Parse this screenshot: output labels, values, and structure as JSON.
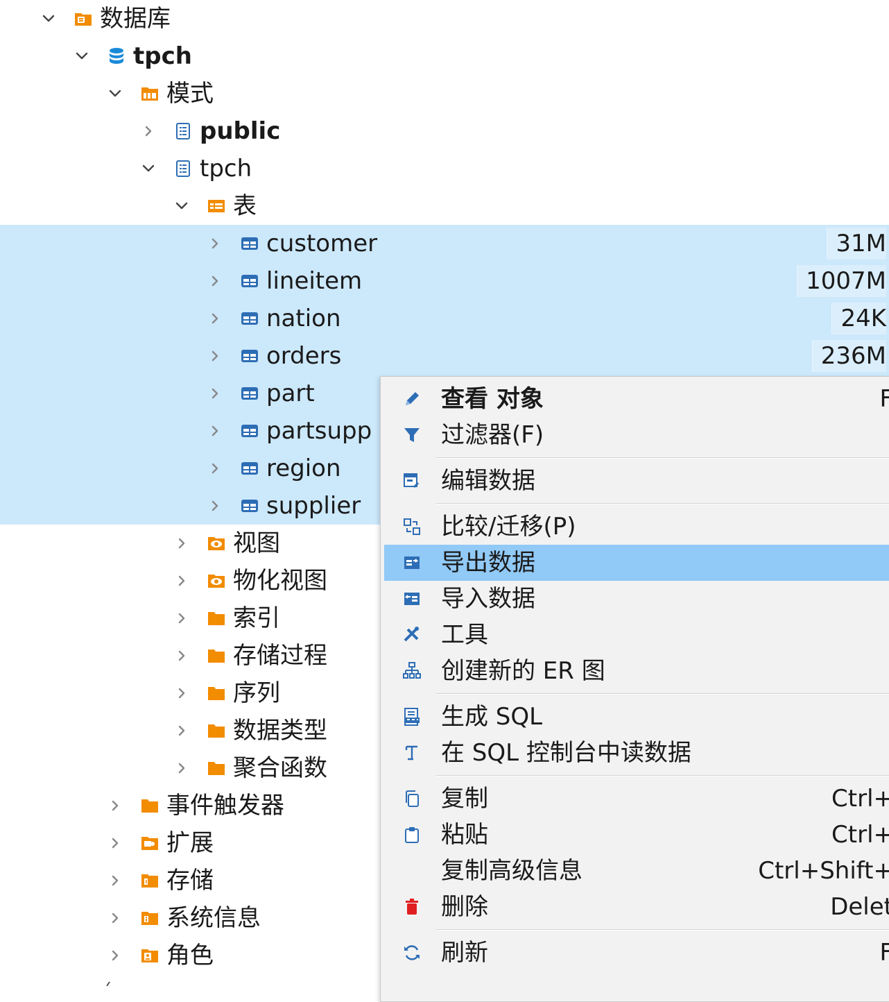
{
  "tree": {
    "rows": [
      {
        "label": "数据库",
        "indent": 0,
        "chevron": "down",
        "icon": "database-folder-icon"
      },
      {
        "label": "tpch",
        "indent": 1,
        "chevron": "down",
        "icon": "database-icon",
        "bold": true
      },
      {
        "label": "模式",
        "indent": 2,
        "chevron": "down",
        "icon": "schemas-folder-icon"
      },
      {
        "label": "public",
        "indent": 3,
        "chevron": "right",
        "icon": "schema-icon",
        "bold": true
      },
      {
        "label": "tpch",
        "indent": 3,
        "chevron": "down",
        "icon": "schema-icon"
      },
      {
        "label": "表",
        "indent": 4,
        "chevron": "down",
        "icon": "tables-folder-icon"
      },
      {
        "label": "customer",
        "indent": 5,
        "chevron": "right",
        "icon": "table-icon",
        "selected": true,
        "size": "31M"
      },
      {
        "label": "lineitem",
        "indent": 5,
        "chevron": "right",
        "icon": "table-icon",
        "selected": true,
        "size": "1007M"
      },
      {
        "label": "nation",
        "indent": 5,
        "chevron": "right",
        "icon": "table-icon",
        "selected": true,
        "size": "24K"
      },
      {
        "label": "orders",
        "indent": 5,
        "chevron": "right",
        "icon": "table-icon",
        "selected": true,
        "size": "236M"
      },
      {
        "label": "part",
        "indent": 5,
        "chevron": "right",
        "icon": "table-icon",
        "selected": true
      },
      {
        "label": "partsupp",
        "indent": 5,
        "chevron": "right",
        "icon": "table-icon",
        "selected": true
      },
      {
        "label": "region",
        "indent": 5,
        "chevron": "right",
        "icon": "table-icon",
        "selected": true
      },
      {
        "label": "supplier",
        "indent": 5,
        "chevron": "right",
        "icon": "table-icon",
        "selected": true
      },
      {
        "label": "视图",
        "indent": 4,
        "chevron": "right",
        "icon": "view-folder-icon"
      },
      {
        "label": "物化视图",
        "indent": 4,
        "chevron": "right",
        "icon": "view-folder-icon"
      },
      {
        "label": "索引",
        "indent": 4,
        "chevron": "right",
        "icon": "folder-icon"
      },
      {
        "label": "存储过程",
        "indent": 4,
        "chevron": "right",
        "icon": "folder-icon"
      },
      {
        "label": "序列",
        "indent": 4,
        "chevron": "right",
        "icon": "folder-icon"
      },
      {
        "label": "数据类型",
        "indent": 4,
        "chevron": "right",
        "icon": "folder-icon"
      },
      {
        "label": "聚合函数",
        "indent": 4,
        "chevron": "right",
        "icon": "folder-icon"
      },
      {
        "label": "事件触发器",
        "indent": 2,
        "chevron": "right",
        "icon": "folder-icon"
      },
      {
        "label": "扩展",
        "indent": 2,
        "chevron": "right",
        "icon": "extension-folder-icon"
      },
      {
        "label": "存储",
        "indent": 2,
        "chevron": "right",
        "icon": "storage-folder-icon"
      },
      {
        "label": "系统信息",
        "indent": 2,
        "chevron": "right",
        "icon": "system-info-folder-icon"
      },
      {
        "label": "角色",
        "indent": 2,
        "chevron": "right",
        "icon": "roles-folder-icon"
      }
    ]
  },
  "context_menu": {
    "items": [
      {
        "label": "查看 对象",
        "shortcut": "F",
        "icon": "pencil-icon",
        "bold": true
      },
      {
        "label": "过滤器(F)",
        "shortcut": "",
        "icon": "filter-icon"
      },
      {
        "separator": true
      },
      {
        "label": "编辑数据",
        "shortcut": "",
        "icon": "edit-data-icon"
      },
      {
        "separator": true
      },
      {
        "label": "比较/迁移(P)",
        "shortcut": "",
        "icon": "compare-icon"
      },
      {
        "label": "导出数据",
        "shortcut": "",
        "icon": "export-data-icon",
        "highlighted": true
      },
      {
        "label": "导入数据",
        "shortcut": "",
        "icon": "import-data-icon"
      },
      {
        "label": "工具",
        "shortcut": "",
        "icon": "tools-icon"
      },
      {
        "label": "创建新的 ER 图",
        "shortcut": "",
        "icon": "er-diagram-icon"
      },
      {
        "separator": true
      },
      {
        "label": "生成 SQL",
        "shortcut": "",
        "icon": "generate-sql-icon"
      },
      {
        "label": "在 SQL 控制台中读数据",
        "shortcut": "",
        "icon": "sql-console-icon"
      },
      {
        "separator": true
      },
      {
        "label": "复制",
        "shortcut": "Ctrl+",
        "icon": "copy-icon"
      },
      {
        "label": "粘贴",
        "shortcut": "Ctrl+",
        "icon": "paste-icon"
      },
      {
        "label": "复制高级信息",
        "shortcut": "Ctrl+Shift+",
        "icon": ""
      },
      {
        "label": "删除",
        "shortcut": "Delet",
        "icon": "delete-icon"
      },
      {
        "separator": true
      },
      {
        "label": "刷新",
        "shortcut": "F",
        "icon": "refresh-icon"
      }
    ]
  },
  "colors": {
    "selection": "#cce8fb",
    "menu_highlight": "#91c9f7",
    "folder_orange": "#f28c00",
    "db_blue": "#1a8ad8",
    "table_blue": "#2d6db5"
  }
}
